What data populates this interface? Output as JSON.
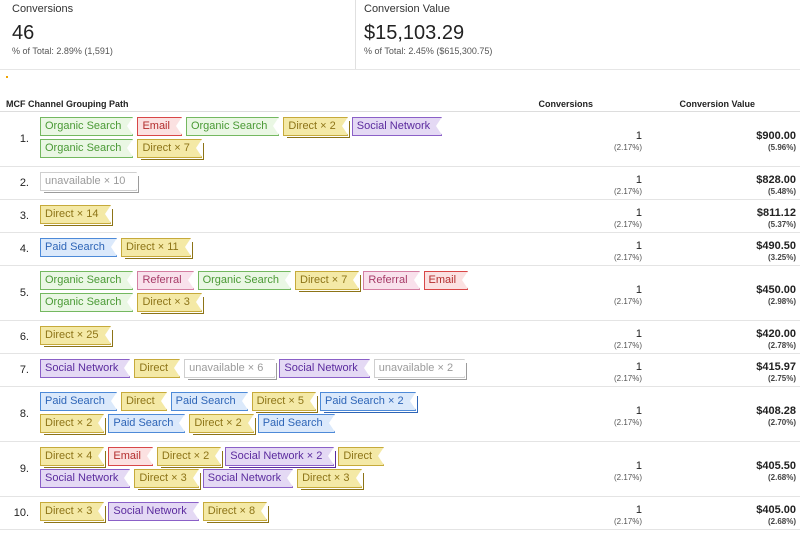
{
  "summary": {
    "conversions": {
      "label": "Conversions",
      "value": "46",
      "sub": "% of Total: 2.89% (1,591)"
    },
    "conversion_value": {
      "label": "Conversion Value",
      "value": "$15,103.29",
      "sub": "% of Total: 2.45% ($615,300.75)"
    }
  },
  "table": {
    "headers": {
      "path": "MCF Channel Grouping Path",
      "conversions": "Conversions",
      "value": "Conversion Value"
    },
    "rows": [
      {
        "num": "1.",
        "conversions": "1",
        "conversions_pct": "(2.17%)",
        "value": "$900.00",
        "value_pct": "(5.96%)",
        "lines": [
          [
            {
              "label": "Organic Search",
              "channel": "organic"
            },
            {
              "label": "Email",
              "channel": "email"
            },
            {
              "label": "Organic Search",
              "channel": "organic"
            },
            {
              "label": "Direct × 2",
              "channel": "direct",
              "stack": true
            },
            {
              "label": "Social Network",
              "channel": "social"
            }
          ],
          [
            {
              "label": "Organic Search",
              "channel": "organic"
            },
            {
              "label": "Direct × 7",
              "channel": "direct",
              "stack": true
            }
          ]
        ]
      },
      {
        "num": "2.",
        "conversions": "1",
        "conversions_pct": "(2.17%)",
        "value": "$828.00",
        "value_pct": "(5.48%)",
        "lines": [
          [
            {
              "label": "unavailable × 10",
              "channel": "unavail",
              "stack": true
            }
          ]
        ]
      },
      {
        "num": "3.",
        "conversions": "1",
        "conversions_pct": "(2.17%)",
        "value": "$811.12",
        "value_pct": "(5.37%)",
        "lines": [
          [
            {
              "label": "Direct × 14",
              "channel": "direct",
              "stack": true
            }
          ]
        ]
      },
      {
        "num": "4.",
        "conversions": "1",
        "conversions_pct": "(2.17%)",
        "value": "$490.50",
        "value_pct": "(3.25%)",
        "lines": [
          [
            {
              "label": "Paid Search",
              "channel": "paid"
            },
            {
              "label": "Direct × 11",
              "channel": "direct",
              "stack": true
            }
          ]
        ]
      },
      {
        "num": "5.",
        "conversions": "1",
        "conversions_pct": "(2.17%)",
        "value": "$450.00",
        "value_pct": "(2.98%)",
        "lines": [
          [
            {
              "label": "Organic Search",
              "channel": "organic"
            },
            {
              "label": "Referral",
              "channel": "referral"
            },
            {
              "label": "Organic Search",
              "channel": "organic"
            },
            {
              "label": "Direct × 7",
              "channel": "direct",
              "stack": true
            },
            {
              "label": "Referral",
              "channel": "referral"
            },
            {
              "label": "Email",
              "channel": "email"
            }
          ],
          [
            {
              "label": "Organic Search",
              "channel": "organic"
            },
            {
              "label": "Direct × 3",
              "channel": "direct",
              "stack": true
            }
          ]
        ]
      },
      {
        "num": "6.",
        "conversions": "1",
        "conversions_pct": "(2.17%)",
        "value": "$420.00",
        "value_pct": "(2.78%)",
        "lines": [
          [
            {
              "label": "Direct × 25",
              "channel": "direct",
              "stack": true
            }
          ]
        ]
      },
      {
        "num": "7.",
        "conversions": "1",
        "conversions_pct": "(2.17%)",
        "value": "$415.97",
        "value_pct": "(2.75%)",
        "lines": [
          [
            {
              "label": "Social Network",
              "channel": "social"
            },
            {
              "label": "Direct",
              "channel": "direct"
            },
            {
              "label": "unavailable × 6",
              "channel": "unavail",
              "stack": true
            },
            {
              "label": "Social Network",
              "channel": "social"
            },
            {
              "label": "unavailable × 2",
              "channel": "unavail",
              "stack": true
            }
          ]
        ]
      },
      {
        "num": "8.",
        "conversions": "1",
        "conversions_pct": "(2.17%)",
        "value": "$408.28",
        "value_pct": "(2.70%)",
        "lines": [
          [
            {
              "label": "Paid Search",
              "channel": "paid"
            },
            {
              "label": "Direct",
              "channel": "direct"
            },
            {
              "label": "Paid Search",
              "channel": "paid"
            },
            {
              "label": "Direct × 5",
              "channel": "direct",
              "stack": true
            },
            {
              "label": "Paid Search × 2",
              "channel": "paid",
              "stack": true
            }
          ],
          [
            {
              "label": "Direct × 2",
              "channel": "direct",
              "stack": true
            },
            {
              "label": "Paid Search",
              "channel": "paid"
            },
            {
              "label": "Direct × 2",
              "channel": "direct",
              "stack": true
            },
            {
              "label": "Paid Search",
              "channel": "paid"
            }
          ]
        ]
      },
      {
        "num": "9.",
        "conversions": "1",
        "conversions_pct": "(2.17%)",
        "value": "$405.50",
        "value_pct": "(2.68%)",
        "lines": [
          [
            {
              "label": "Direct × 4",
              "channel": "direct",
              "stack": true
            },
            {
              "label": "Email",
              "channel": "email"
            },
            {
              "label": "Direct × 2",
              "channel": "direct",
              "stack": true
            },
            {
              "label": "Social Network × 2",
              "channel": "social",
              "stack": true
            },
            {
              "label": "Direct",
              "channel": "direct"
            }
          ],
          [
            {
              "label": "Social Network",
              "channel": "social"
            },
            {
              "label": "Direct × 3",
              "channel": "direct",
              "stack": true
            },
            {
              "label": "Social Network",
              "channel": "social"
            },
            {
              "label": "Direct × 3",
              "channel": "direct",
              "stack": true
            }
          ]
        ]
      },
      {
        "num": "10.",
        "conversions": "1",
        "conversions_pct": "(2.17%)",
        "value": "$405.00",
        "value_pct": "(2.68%)",
        "lines": [
          [
            {
              "label": "Direct × 3",
              "channel": "direct",
              "stack": true
            },
            {
              "label": "Social Network",
              "channel": "social"
            },
            {
              "label": "Direct × 8",
              "channel": "direct",
              "stack": true
            }
          ]
        ]
      }
    ]
  }
}
